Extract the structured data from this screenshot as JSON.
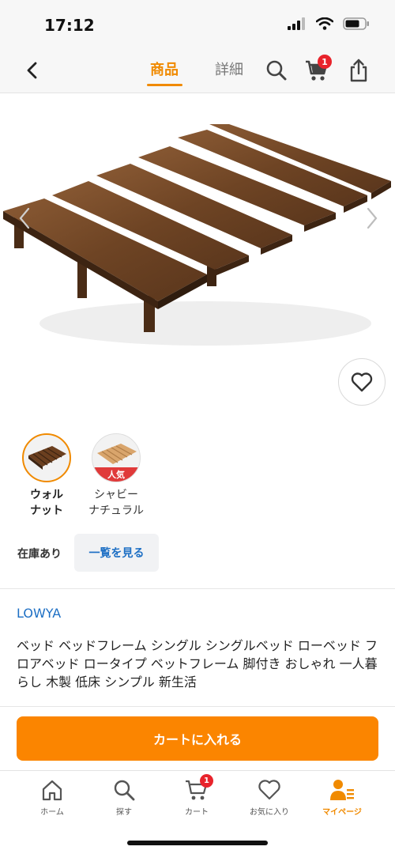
{
  "status_bar": {
    "time": "17:12"
  },
  "header": {
    "tabs": [
      {
        "label": "商品",
        "active": true
      },
      {
        "label": "詳細",
        "active": false
      }
    ],
    "cart_badge": "1"
  },
  "variants": [
    {
      "label": "ウォル\nナット",
      "selected": true,
      "color": "#6b3f1f"
    },
    {
      "label": "シャビー\nナチュラル",
      "selected": false,
      "badge": "人気",
      "color": "#d9a56c"
    }
  ],
  "stock": {
    "label": "在庫あり",
    "list_button": "一覧を見る"
  },
  "product": {
    "brand": "LOWYA",
    "title": "ベッド ベッドフレーム シングル シングルベッド ローベッド フロアベッド ロータイプ ベットフレーム 脚付き おしゃれ 一人暮らし 木製 低床 シンプル 新生活"
  },
  "cart_button": "カートに入れる",
  "tab_bar": {
    "items": [
      {
        "label": "ホーム",
        "icon": "home-icon"
      },
      {
        "label": "探す",
        "icon": "search-icon"
      },
      {
        "label": "カート",
        "icon": "cart-icon",
        "badge": "1"
      },
      {
        "label": "お気に入り",
        "icon": "heart-icon"
      },
      {
        "label": "マイページ",
        "icon": "user-icon",
        "active": true
      }
    ]
  },
  "colors": {
    "accent": "#f08a00",
    "button": "#fb8500",
    "link": "#1d6fc4",
    "badge": "#e8232b"
  }
}
